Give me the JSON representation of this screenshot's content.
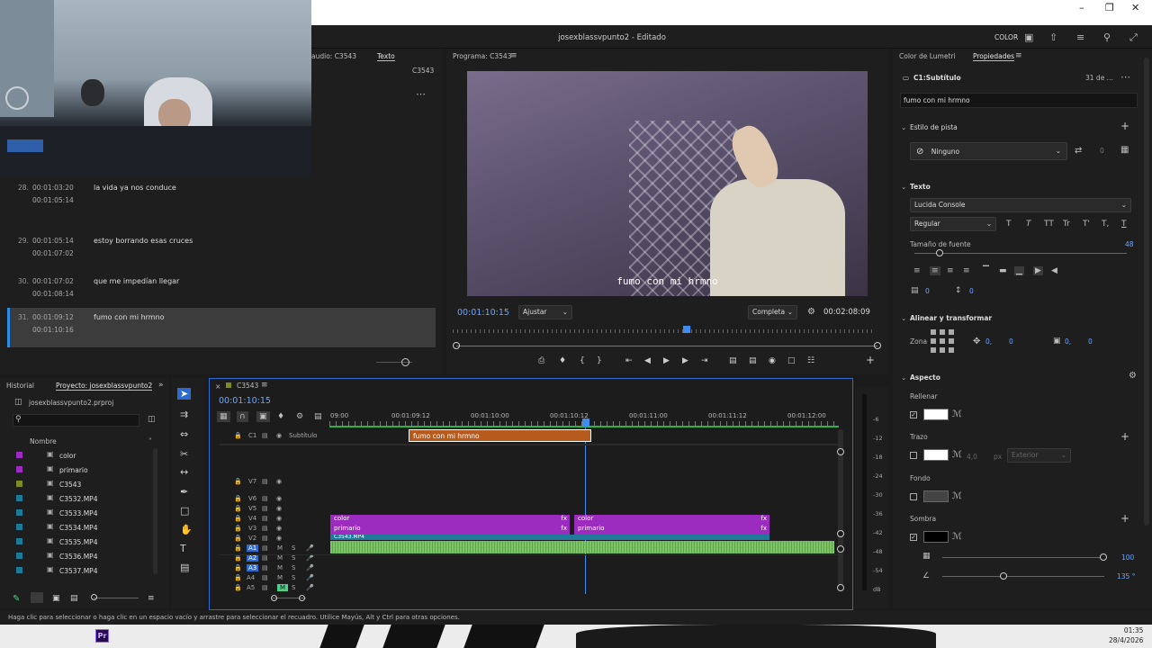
{
  "window": {
    "title": "josexblassvpunto2 - Editado",
    "workspace_label": "COLOR"
  },
  "source_panel": {
    "tabs": [
      "audio: C3543",
      "Texto"
    ],
    "sequence": "C3543",
    "captions": [
      {
        "num": "28.",
        "in": "00:01:03:20",
        "out": "00:01:05:14",
        "text": "la vida ya nos conduce"
      },
      {
        "num": "29.",
        "in": "00:01:05:14",
        "out": "00:01:07:02",
        "text": "estoy borrando esas cruces"
      },
      {
        "num": "30.",
        "in": "00:01:07:02",
        "out": "00:01:08:14",
        "text": "que me impedían llegar"
      },
      {
        "num": "31.",
        "in": "00:01:09:12",
        "out": "00:01:10:16",
        "text": "fumo con mi hrmno"
      }
    ]
  },
  "program": {
    "title": "Programa: C3543",
    "subtitle": "fumo con mi hrmno",
    "current_time": "00:01:10:15",
    "fit": "Ajustar",
    "quality": "Completa",
    "duration": "00:02:08:09"
  },
  "properties": {
    "tabs": [
      "Color de Lumetri",
      "Propiedades"
    ],
    "clip_name": "C1:Subtítulo",
    "clip_date": "31 de ...",
    "text_value": "fumo con mi hrmno",
    "track_style_label": "Estilo de pista",
    "track_style_value": "Ninguno",
    "track_style_num": "0",
    "text_section": "Texto",
    "font": "Lucida Console",
    "font_style": "Regular",
    "font_size_label": "Tamaño de fuente",
    "font_size": "48",
    "tracking": "0",
    "leading": "0",
    "align_section": "Alinear y transformar",
    "zone_label": "Zona",
    "pos_x": "0,",
    "pos_y": "0",
    "scale_x": "0,",
    "scale_y": "0",
    "aspect_section": "Aspecto",
    "fill_label": "Rellenar",
    "stroke_label": "Trazo",
    "stroke_width": "4,0",
    "stroke_unit": "px",
    "stroke_pos": "Exterior",
    "bg_label": "Fondo",
    "shadow_label": "Sombra",
    "shadow_opacity": "100",
    "shadow_angle": "135 °"
  },
  "project": {
    "tabs": [
      "Historial",
      "Proyecto: josexblassvpunto2"
    ],
    "file": "josexblassvpunto2.prproj",
    "column": "Nombre",
    "items": [
      {
        "name": "color",
        "color": "#9c2bbf"
      },
      {
        "name": "primario",
        "color": "#9c2bbf"
      },
      {
        "name": "C3543",
        "color": "#7f8a25"
      },
      {
        "name": "C3532.MP4",
        "color": "#1f7a99"
      },
      {
        "name": "C3533.MP4",
        "color": "#1f7a99"
      },
      {
        "name": "C3534.MP4",
        "color": "#1f7a99"
      },
      {
        "name": "C3535.MP4",
        "color": "#1f7a99"
      },
      {
        "name": "C3536.MP4",
        "color": "#1f7a99"
      },
      {
        "name": "C3537.MP4",
        "color": "#1f7a99"
      }
    ]
  },
  "timeline": {
    "sequence": "C3543",
    "timecode": "00:01:10:15",
    "ruler": [
      "09:00",
      "00:01:09:12",
      "00:01:10:00",
      "00:01:10:12",
      "00:01:11:00",
      "00:01:11:12",
      "00:01:12:00"
    ],
    "caption_track": "C1",
    "caption_track_name": "Subtítulo",
    "caption_clip": "fumo con mi hrmno",
    "tracks_video": [
      "V7",
      "V6",
      "V5",
      "V4",
      "V3",
      "V2"
    ],
    "tracks_audio": [
      "A1",
      "A2",
      "A3",
      "A4",
      "A5"
    ],
    "clips": [
      {
        "label": "color",
        "fx": "fx"
      },
      {
        "label": "color",
        "fx": "fx"
      },
      {
        "label": "primario",
        "fx": "fx"
      },
      {
        "label": "primario",
        "fx": "fx"
      },
      {
        "label": "C3543.MP4",
        "fx": ""
      }
    ],
    "meter_db": [
      "-6",
      "-12",
      "-18",
      "-24",
      "-30",
      "-36",
      "-42",
      "-48",
      "-54",
      "dB"
    ]
  },
  "status": "Haga clic para seleccionar o haga clic en un espacio vacío y arrastre para seleccionar el recuadro. Utilice Mayús, Alt y Ctrl para otras opciones.",
  "taskbar": {
    "time": "01:35",
    "date": "28/4/2026",
    "app": "Pr"
  }
}
